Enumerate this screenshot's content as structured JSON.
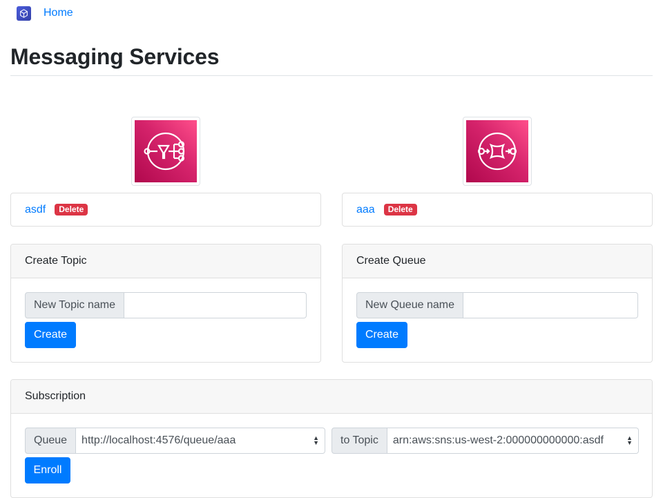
{
  "nav": {
    "home_label": "Home",
    "logo_icon": "cube-icon"
  },
  "page": {
    "title": "Messaging Services"
  },
  "topics": {
    "icon": "sns-topic-icon",
    "items": [
      {
        "name": "asdf",
        "delete_label": "Delete"
      }
    ],
    "create": {
      "header": "Create Topic",
      "input_label": "New Topic name",
      "input_value": "",
      "button_label": "Create"
    }
  },
  "queues": {
    "icon": "sqs-queue-icon",
    "items": [
      {
        "name": "aaa",
        "delete_label": "Delete"
      }
    ],
    "create": {
      "header": "Create Queue",
      "input_label": "New Queue name",
      "input_value": "",
      "button_label": "Create"
    }
  },
  "subscription": {
    "header": "Subscription",
    "queue_label": "Queue",
    "queue_selected": "http://localhost:4576/queue/aaa",
    "topic_label": "to Topic",
    "topic_selected": "arn:aws:sns:us-west-2:000000000000:asdf",
    "button_label": "Enroll"
  },
  "colors": {
    "primary": "#007bff",
    "danger": "#dc3545",
    "aws_pink": "#d5236b"
  }
}
